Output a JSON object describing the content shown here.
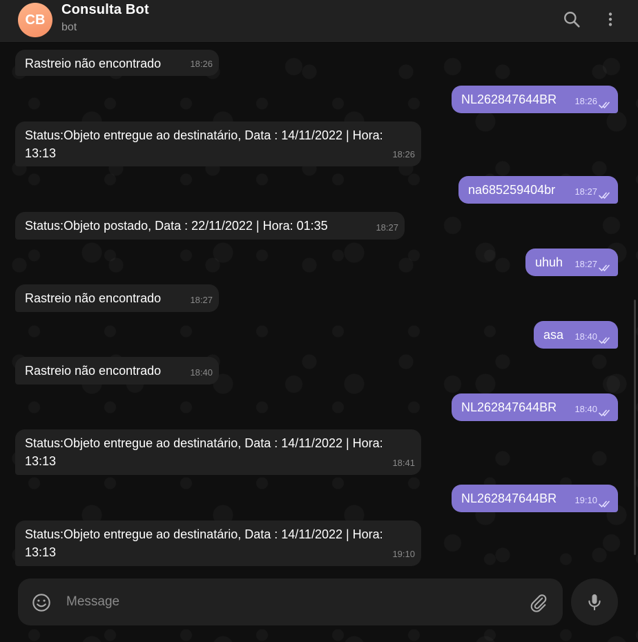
{
  "header": {
    "avatar_initials": "CB",
    "title": "Consulta Bot",
    "subtitle": "bot",
    "avatar_color": "#f79b6e"
  },
  "messages": [
    {
      "dir": "in",
      "text": "Rastreio não encontrado",
      "time": "18:26"
    },
    {
      "dir": "out",
      "text": "NL262847644BR",
      "time": "18:26"
    },
    {
      "dir": "in",
      "text": "Status:Objeto entregue ao destinatário, Data : 14/11/2022 | Hora: 13:13",
      "time": "18:26"
    },
    {
      "dir": "out",
      "text": "na685259404br",
      "time": "18:27"
    },
    {
      "dir": "in",
      "text": "Status:Objeto postado, Data : 22/11/2022 | Hora: 01:35",
      "time": "18:27"
    },
    {
      "dir": "out",
      "text": "uhuh",
      "time": "18:27"
    },
    {
      "dir": "in",
      "text": "Rastreio não encontrado",
      "time": "18:27"
    },
    {
      "dir": "out",
      "text": "asa",
      "time": "18:40"
    },
    {
      "dir": "in",
      "text": "Rastreio não encontrado",
      "time": "18:40"
    },
    {
      "dir": "out",
      "text": "NL262847644BR",
      "time": "18:40"
    },
    {
      "dir": "in",
      "text": "Status:Objeto entregue ao destinatário, Data : 14/11/2022 | Hora: 13:13",
      "time": "18:41"
    },
    {
      "dir": "out",
      "text": "NL262847644BR",
      "time": "19:10"
    },
    {
      "dir": "in",
      "text": "Status:Objeto entregue ao destinatário, Data : 14/11/2022 | Hora: 13:13",
      "time": "19:10"
    }
  ],
  "composer": {
    "placeholder": "Message"
  },
  "colors": {
    "outgoing_bubble": "#8274d0",
    "incoming_bubble": "#212121",
    "background": "#0f0f0f"
  }
}
